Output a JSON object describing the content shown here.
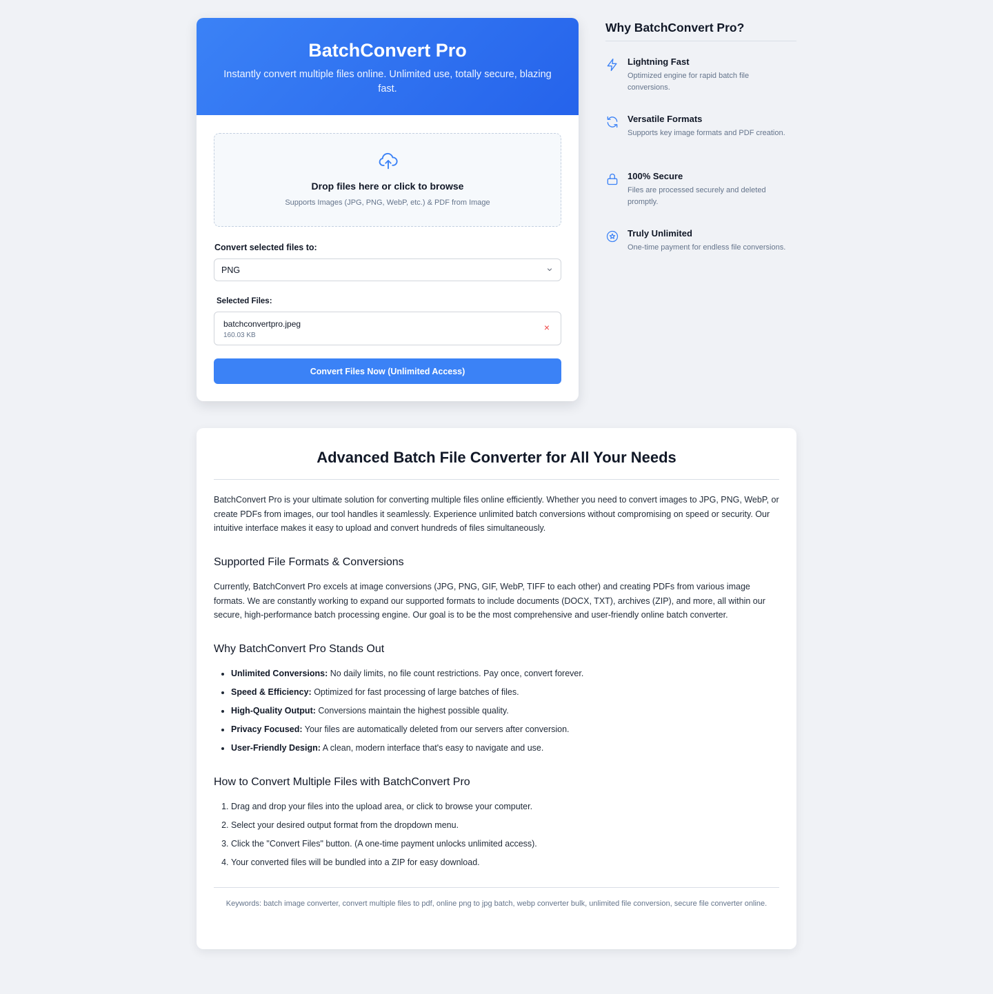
{
  "converter": {
    "title": "BatchConvert Pro",
    "subtitle": "Instantly convert multiple files online. Unlimited use, totally secure, blazing fast.",
    "dropzone": {
      "title": "Drop files here or click to browse",
      "subtitle": "Supports Images (JPG, PNG, WebP, etc.) & PDF from Image"
    },
    "format_label": "Convert selected files to:",
    "format_selected": "PNG",
    "selected_files_label": "Selected Files:",
    "files": [
      {
        "name": "batchconvertpro.jpeg",
        "size": "160.03 KB",
        "remove": "×"
      }
    ],
    "convert_button": "Convert Files Now (Unlimited Access)"
  },
  "sidebar": {
    "title": "Why BatchConvert Pro?",
    "features": [
      {
        "icon": "lightning-icon",
        "title": "Lightning Fast",
        "desc": "Optimized engine for rapid batch file conversions."
      },
      {
        "icon": "refresh-icon",
        "title": "Versatile Formats",
        "desc": "Supports key image formats and PDF creation."
      },
      {
        "icon": "lock-icon",
        "title": "100% Secure",
        "desc": "Files are processed securely and deleted promptly."
      },
      {
        "icon": "star-circle-icon",
        "title": "Truly Unlimited",
        "desc": "One-time payment for endless file conversions."
      }
    ]
  },
  "article": {
    "title": "Advanced Batch File Converter for All Your Needs",
    "intro": "BatchConvert Pro is your ultimate solution for converting multiple files online efficiently. Whether you need to convert images to JPG, PNG, WebP, or create PDFs from images, our tool handles it seamlessly. Experience unlimited batch conversions without compromising on speed or security. Our intuitive interface makes it easy to upload and convert hundreds of files simultaneously.",
    "formats_heading": "Supported File Formats & Conversions",
    "formats_text": "Currently, BatchConvert Pro excels at image conversions (JPG, PNG, GIF, WebP, TIFF to each other) and creating PDFs from various image formats. We are constantly working to expand our supported formats to include documents (DOCX, TXT), archives (ZIP), and more, all within our secure, high-performance batch processing engine. Our goal is to be the most comprehensive and user-friendly online batch converter.",
    "standout_heading": "Why BatchConvert Pro Stands Out",
    "standout_items": [
      {
        "label": "Unlimited Conversions:",
        "text": "No daily limits, no file count restrictions. Pay once, convert forever."
      },
      {
        "label": "Speed & Efficiency:",
        "text": "Optimized for fast processing of large batches of files."
      },
      {
        "label": "High-Quality Output:",
        "text": "Conversions maintain the highest possible quality."
      },
      {
        "label": "Privacy Focused:",
        "text": "Your files are automatically deleted from our servers after conversion."
      },
      {
        "label": "User-Friendly Design:",
        "text": "A clean, modern interface that's easy to navigate and use."
      }
    ],
    "howto_heading": "How to Convert Multiple Files with BatchConvert Pro",
    "howto_steps": [
      "Drag and drop your files into the upload area, or click to browse your computer.",
      "Select your desired output format from the dropdown menu.",
      "Click the \"Convert Files\" button. (A one-time payment unlocks unlimited access).",
      "Your converted files will be bundled into a ZIP for easy download."
    ],
    "keywords": "Keywords: batch image converter, convert multiple files to pdf, online png to jpg batch, webp converter bulk, unlimited file conversion, secure file converter online."
  },
  "colors": {
    "accent": "#3b82f6",
    "accent_dark": "#2563eb",
    "background": "#f0f2f6",
    "remove": "#ef4444"
  }
}
